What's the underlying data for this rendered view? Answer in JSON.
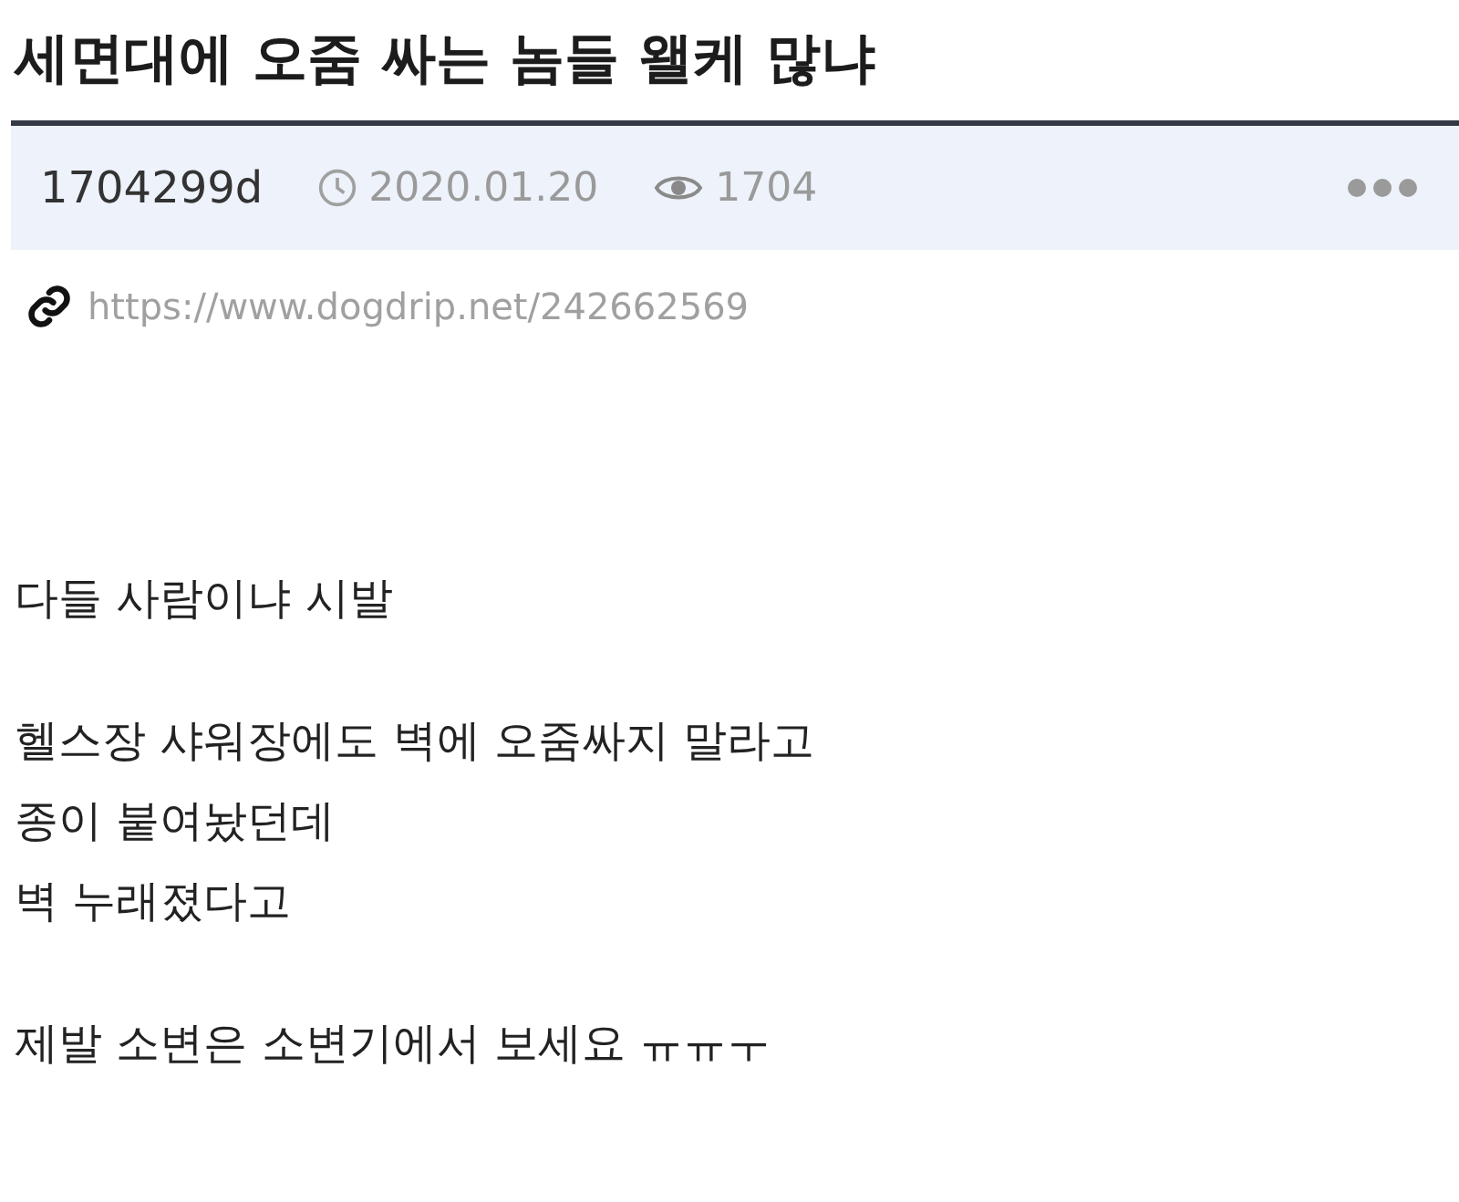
{
  "post": {
    "title": "세면대에 오줌 싸는 놈들 왤케 많냐",
    "author": "1704299d",
    "date": "2020.01.20",
    "views": "1704",
    "link": "https://www.dogdrip.net/242662569",
    "paragraphs": [
      [
        "다들 사람이냐 시발"
      ],
      [
        "헬스장 샤워장에도 벽에 오줌싸지 말라고",
        "종이 붙여놨던데",
        "벽 누래졌다고"
      ],
      [
        "제발 소변은 소변기에서 보세요 ㅠㅠㅜ"
      ]
    ]
  }
}
